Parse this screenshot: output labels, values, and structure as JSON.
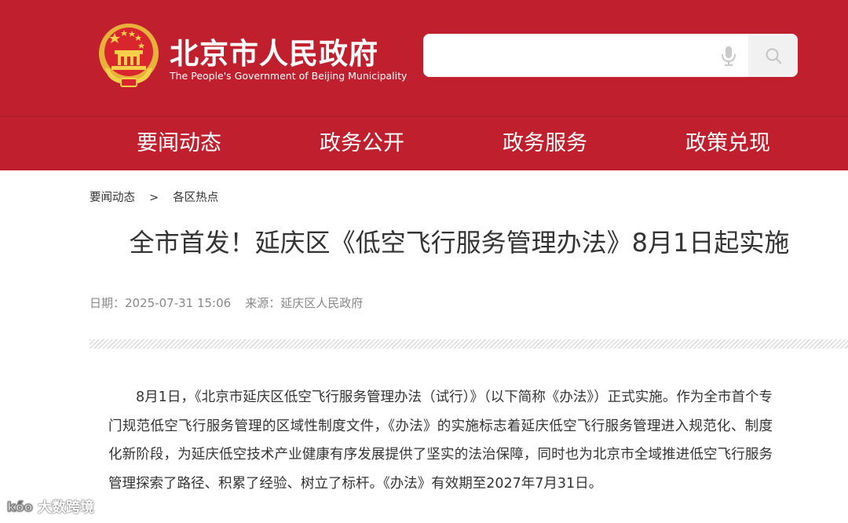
{
  "header": {
    "title": "北京市人民政府",
    "subtitle": "The People's Government of Beijing Municipality",
    "search": {
      "placeholder": ""
    },
    "colors": {
      "brand": "#c0202e",
      "white": "#ffffff"
    },
    "icons": {
      "emblem": "national-emblem-icon",
      "mic": "microphone-icon",
      "search": "search-icon"
    }
  },
  "nav": {
    "items": [
      {
        "label": "要闻动态"
      },
      {
        "label": "政务公开"
      },
      {
        "label": "政务服务"
      },
      {
        "label": "政策兑现"
      }
    ]
  },
  "breadcrumb": {
    "items": [
      "要闻动态",
      "各区热点"
    ],
    "separator": ">"
  },
  "article": {
    "title": "全市首发！延庆区《低空飞行服务管理办法》8月1日起实施",
    "date_label": "日期：",
    "date": "2025-07-31 15:06",
    "source_label": "来源：",
    "source": "延庆区人民政府",
    "body": "8月1日，《北京市延庆区低空飞行服务管理办法（试行）》（以下简称《办法》）正式实施。作为全市首个专门规范低空飞行服务管理的区域性制度文件，《办法》的实施标志着延庆低空飞行服务管理进入规范化、制度化新阶段，为延庆低空技术产业健康有序发展提供了坚实的法治保障，同时也为北京市全域推进低空飞行服务管理探索了路径、积累了经验、树立了标杆。《办法》有效期至2027年7月31日。"
  },
  "watermark": {
    "text": "大数跨境"
  }
}
